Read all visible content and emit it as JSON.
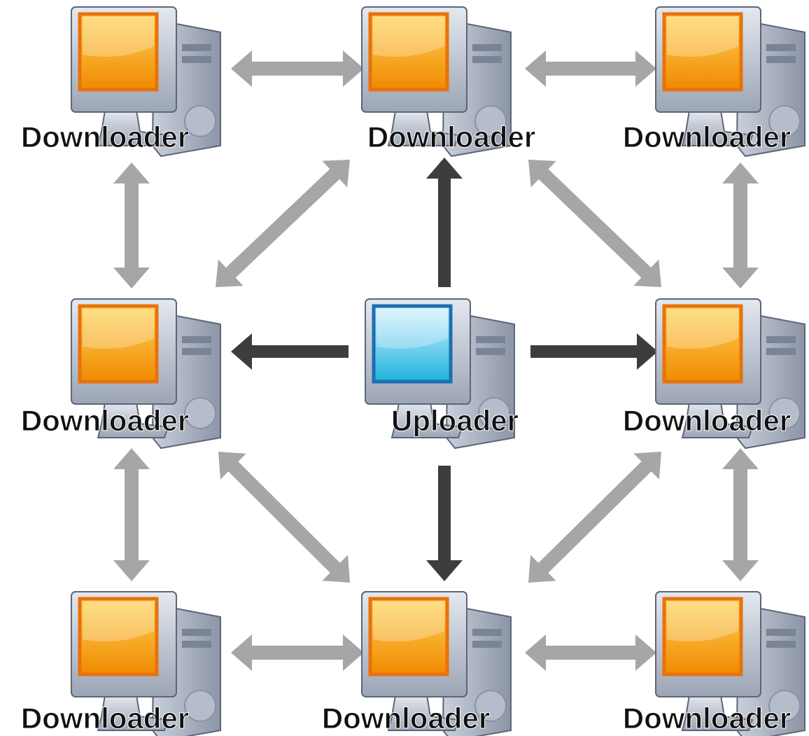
{
  "nodes": [
    {
      "id": "top-left",
      "label": "Downloader",
      "role": "downloader"
    },
    {
      "id": "top-center",
      "label": "Downloader",
      "role": "downloader"
    },
    {
      "id": "top-right",
      "label": "Downloader",
      "role": "downloader"
    },
    {
      "id": "middle-left",
      "label": "Downloader",
      "role": "downloader"
    },
    {
      "id": "center",
      "label": "Uploader",
      "role": "uploader"
    },
    {
      "id": "middle-right",
      "label": "Downloader",
      "role": "downloader"
    },
    {
      "id": "bottom-left",
      "label": "Downloader",
      "role": "downloader"
    },
    {
      "id": "bottom-center",
      "label": "Downloader",
      "role": "downloader"
    },
    {
      "id": "bottom-right",
      "label": "Downloader",
      "role": "downloader"
    }
  ],
  "connections": [
    {
      "from": "center",
      "to": "top-center",
      "type": "upload"
    },
    {
      "from": "center",
      "to": "middle-left",
      "type": "upload"
    },
    {
      "from": "center",
      "to": "middle-right",
      "type": "upload"
    },
    {
      "from": "center",
      "to": "bottom-center",
      "type": "upload"
    },
    {
      "from": "top-left",
      "to": "top-center",
      "type": "peer"
    },
    {
      "from": "top-center",
      "to": "top-right",
      "type": "peer"
    },
    {
      "from": "top-left",
      "to": "middle-left",
      "type": "peer"
    },
    {
      "from": "top-right",
      "to": "middle-right",
      "type": "peer"
    },
    {
      "from": "top-center",
      "to": "middle-left",
      "type": "peer"
    },
    {
      "from": "top-center",
      "to": "middle-right",
      "type": "peer"
    },
    {
      "from": "middle-left",
      "to": "bottom-left",
      "type": "peer"
    },
    {
      "from": "middle-right",
      "to": "bottom-right",
      "type": "peer"
    },
    {
      "from": "middle-left",
      "to": "bottom-center",
      "type": "peer"
    },
    {
      "from": "middle-right",
      "to": "bottom-center",
      "type": "peer"
    },
    {
      "from": "bottom-left",
      "to": "bottom-center",
      "type": "peer"
    },
    {
      "from": "bottom-center",
      "to": "bottom-right",
      "type": "peer"
    }
  ],
  "colors": {
    "peer_arrow": "#a6a6a6",
    "upload_arrow": "#3d3d3d",
    "downloader_screen_top": "#ffd35a",
    "downloader_screen_bottom": "#f08a00",
    "downloader_screen_frame": "#e8720c",
    "uploader_screen_top": "#d8f2ff",
    "uploader_screen_bottom": "#1fb4dd",
    "uploader_screen_frame": "#1a6fb0",
    "case": "#9aa4b4",
    "case_dark": "#5d6678",
    "label_text": "#111111"
  }
}
